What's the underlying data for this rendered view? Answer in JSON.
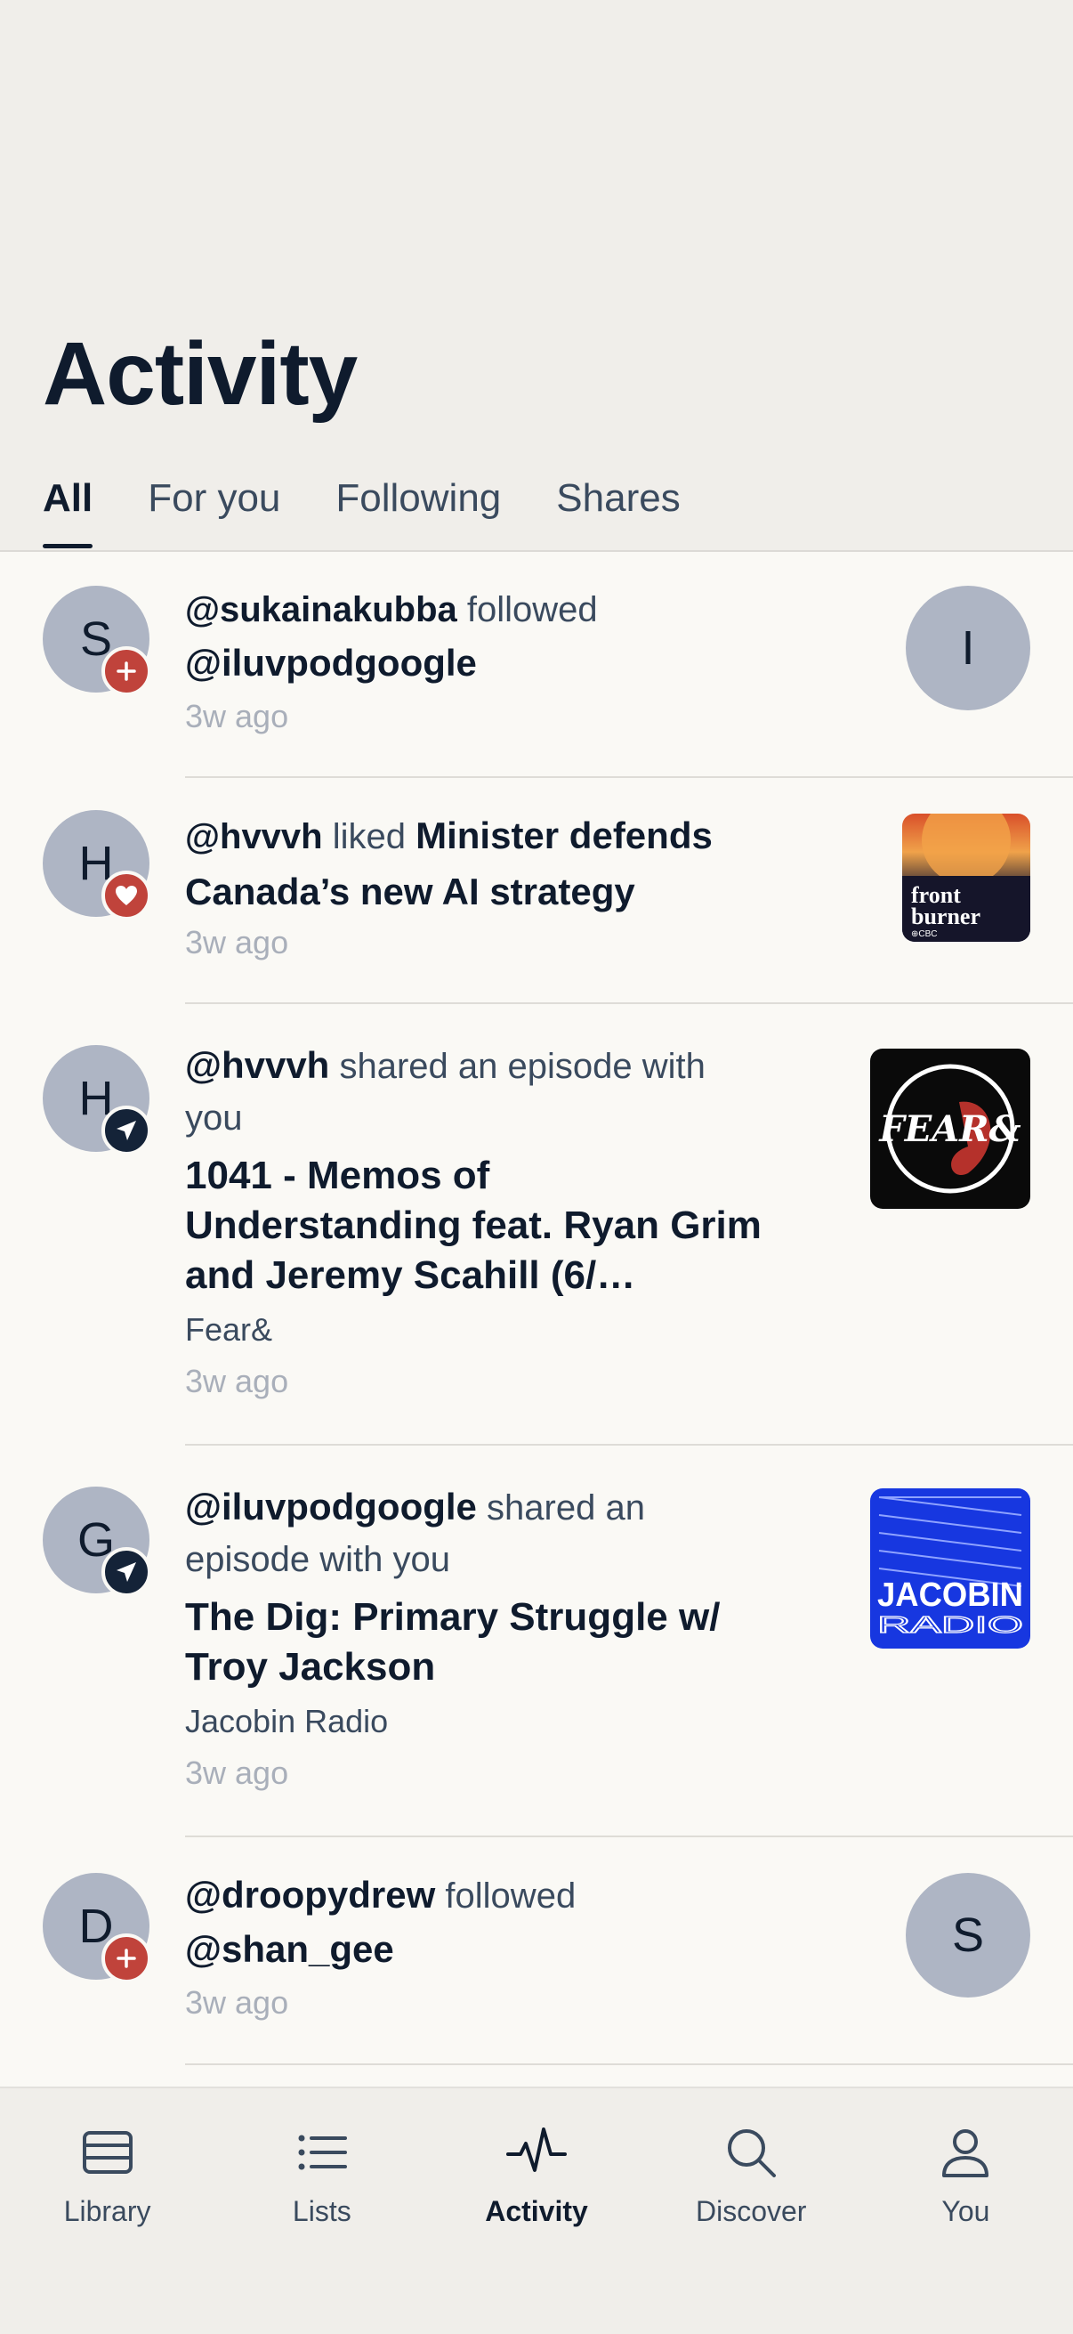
{
  "header": {
    "title": "Activity",
    "tabs": [
      {
        "label": "All",
        "active": true
      },
      {
        "label": "For you"
      },
      {
        "label": "Following"
      },
      {
        "label": "Shares"
      }
    ]
  },
  "feed": [
    {
      "avatar": "S",
      "badge": "plus-icon",
      "user": "@sukainakubba",
      "action": " followed",
      "target": "@iluvpodgoogle",
      "time": "3w ago",
      "right_avatar": "I"
    },
    {
      "avatar": "H",
      "badge": "heart-icon",
      "user": "@hvvvh",
      "action": " liked ",
      "target_inline": "Minister defends Canada’s new AI strategy",
      "time": "3w ago",
      "artwork": {
        "line1": "front",
        "line2": "burner",
        "small": "⊕CBC"
      }
    },
    {
      "avatar": "H",
      "badge": "send-icon",
      "user": "@hvvvh",
      "action": " shared an episode with you",
      "episode": "1041 - Memos of Understanding feat. Ryan Grim and Jeremy Scahill (6/…",
      "podcast": "Fear&",
      "time": "3w ago",
      "artwork": {
        "text": "FEAR&"
      }
    },
    {
      "avatar": "G",
      "badge": "send-icon",
      "user": "@iluvpodgoogle",
      "action": " shared an episode with you",
      "episode": "The Dig: Primary Struggle w/ Troy Jackson",
      "podcast": "Jacobin Radio",
      "time": "3w ago",
      "artwork": {
        "line1": "JACOBIN",
        "line2": "RADIO"
      }
    },
    {
      "avatar": "D",
      "badge": "plus-icon",
      "user": "@droopydrew",
      "action": " followed",
      "target": "@shan_gee",
      "time": "3w ago",
      "right_avatar": "S"
    }
  ],
  "nav": [
    {
      "label": "Library",
      "icon": "library-icon"
    },
    {
      "label": "Lists",
      "icon": "list-icon"
    },
    {
      "label": "Activity",
      "icon": "activity-icon",
      "active": true
    },
    {
      "label": "Discover",
      "icon": "search-icon"
    },
    {
      "label": "You",
      "icon": "user-icon"
    }
  ],
  "colors": {
    "background": "#faf9f5",
    "header_bg": "#f0eeea",
    "text": "#0f1b2d",
    "badge_red": "#c0433b",
    "badge_navy": "#142338",
    "avatar": "#aeb5c4",
    "muted": "#a9afba"
  }
}
